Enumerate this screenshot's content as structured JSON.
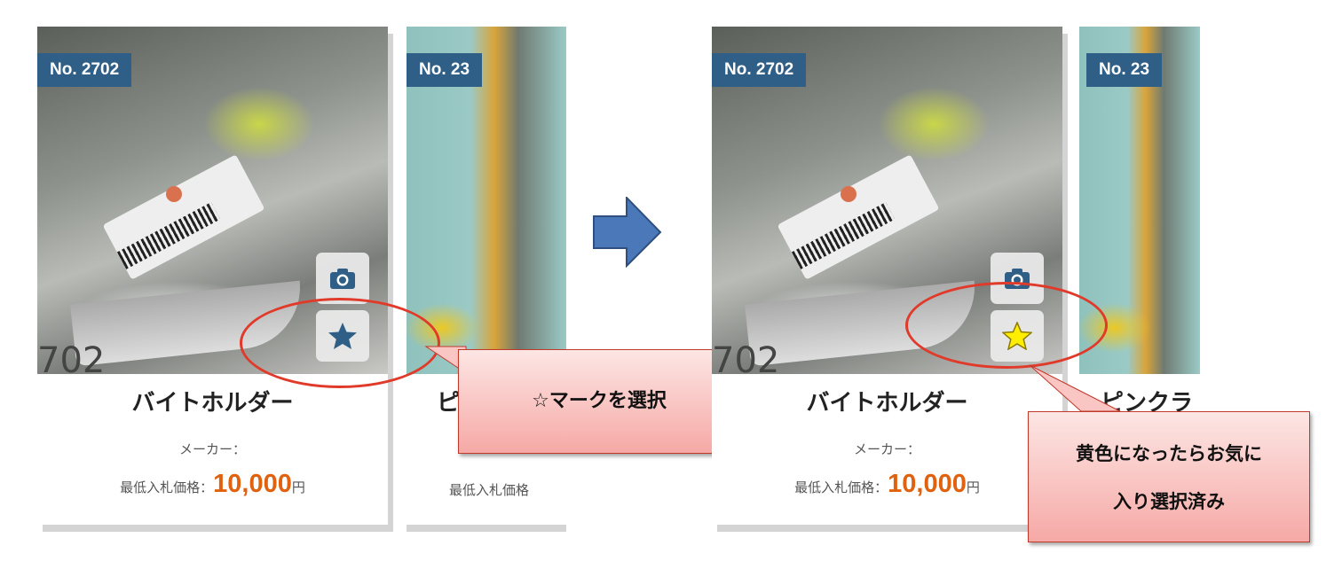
{
  "before": {
    "card": {
      "badge": "No. 2702",
      "photo_digits": "702",
      "title": "バイトホルダー",
      "maker_label": "メーカー：",
      "price_label": "最低入札価格：",
      "price_value": "10,000",
      "price_unit": "円",
      "favorite_state": "unselected",
      "favorite_color": "#2f5f86",
      "camera_icon": "camera-icon",
      "favorite_icon": "star-icon"
    },
    "card2": {
      "badge": "No. 23",
      "title": "ピ",
      "price_label": "最低入札価格"
    },
    "callout": "☆マークを選択"
  },
  "after": {
    "card": {
      "badge": "No. 2702",
      "photo_digits": "702",
      "title": "バイトホルダー",
      "maker_label": "メーカー：",
      "price_label": "最低入札価格：",
      "price_value": "10,000",
      "price_unit": "円",
      "favorite_state": "selected",
      "favorite_color": "#ffee00",
      "camera_icon": "camera-icon",
      "favorite_icon": "star-icon"
    },
    "card2": {
      "badge": "No. 23",
      "title": "ピンクラ"
    },
    "callout_lines": [
      "黄色になったらお気に",
      "入り選択済み"
    ]
  },
  "colors": {
    "badge_bg": "#2f5f86",
    "price": "#e0620f",
    "annotation_red": "#e03a2a",
    "arrow_blue": "#4a78b8"
  }
}
